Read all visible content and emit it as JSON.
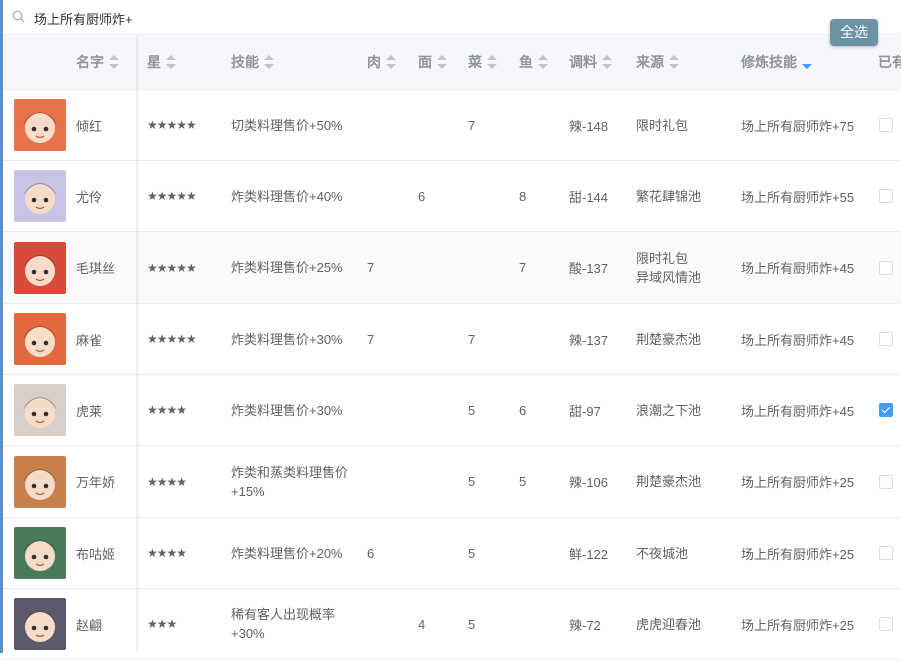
{
  "search": {
    "value": "场上所有厨师炸+"
  },
  "select_all_label": "全选",
  "columns": {
    "name": "名字",
    "stars": "星",
    "skill": "技能",
    "meat": "肉",
    "noodle": "面",
    "veg": "菜",
    "fish": "鱼",
    "seasoning": "调料",
    "source": "来源",
    "ult_skill": "修炼技能",
    "owned": "已有"
  },
  "sorted_column": "修炼技能",
  "rows": [
    {
      "name": "倾红",
      "stars": "★★★★★",
      "skill": "切类料理售价+50%",
      "meat": "",
      "noodle": "",
      "veg": "7",
      "fish": "",
      "seasoning": "辣-148",
      "source": "限时礼包",
      "ult": "场上所有厨师炸+75",
      "owned": false,
      "avatar_color": "#e8724a"
    },
    {
      "name": "尤伶",
      "stars": "★★★★★",
      "skill": "炸类料理售价+40%",
      "meat": "",
      "noodle": "6",
      "veg": "",
      "fish": "8",
      "seasoning": "甜-144",
      "source": "繁花肆锦池",
      "ult": "场上所有厨师炸+55",
      "owned": false,
      "avatar_color": "#c9c3e6"
    },
    {
      "name": "毛琪丝",
      "stars": "★★★★★",
      "skill": "炸类料理售价+25%",
      "meat": "7",
      "noodle": "",
      "veg": "",
      "fish": "7",
      "seasoning": "酸-137",
      "source": "限时礼包\n异域风情池",
      "ult": "场上所有厨师炸+45",
      "owned": false,
      "avatar_color": "#d94a3a"
    },
    {
      "name": "麻雀",
      "stars": "★★★★★",
      "skill": "炸类料理售价+30%",
      "meat": "7",
      "noodle": "",
      "veg": "7",
      "fish": "",
      "seasoning": "辣-137",
      "source": "荆楚豪杰池",
      "ult": "场上所有厨师炸+45",
      "owned": false,
      "avatar_color": "#e06a3c"
    },
    {
      "name": "虎莱",
      "stars": "★★★★",
      "skill": "炸类料理售价+30%",
      "meat": "",
      "noodle": "",
      "veg": "5",
      "fish": "6",
      "seasoning": "甜-97",
      "source": "浪潮之下池",
      "ult": "场上所有厨师炸+45",
      "owned": true,
      "avatar_color": "#d8d0c8"
    },
    {
      "name": "万年娇",
      "stars": "★★★★",
      "skill": "炸类和蒸类料理售价+15%",
      "meat": "",
      "noodle": "",
      "veg": "5",
      "fish": "5",
      "seasoning": "辣-106",
      "source": "荆楚豪杰池",
      "ult": "场上所有厨师炸+25",
      "owned": false,
      "avatar_color": "#c8804a"
    },
    {
      "name": "布咕姬",
      "stars": "★★★★",
      "skill": "炸类料理售价+20%",
      "meat": "6",
      "noodle": "",
      "veg": "5",
      "fish": "",
      "seasoning": "鲜-122",
      "source": "不夜城池",
      "ult": "场上所有厨师炸+25",
      "owned": false,
      "avatar_color": "#4a7a5a"
    },
    {
      "name": "赵翩",
      "stars": "★★★",
      "skill": "稀有客人出现概率+30%",
      "meat": "",
      "noodle": "4",
      "veg": "5",
      "fish": "",
      "seasoning": "辣-72",
      "source": "虎虎迎春池",
      "ult": "场上所有厨师炸+25",
      "owned": false,
      "avatar_color": "#5a5a6a"
    }
  ]
}
